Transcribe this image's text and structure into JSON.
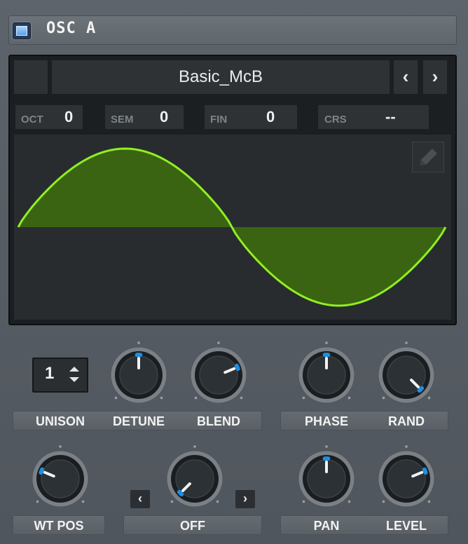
{
  "header": {
    "title": "OSC A",
    "power_on": true
  },
  "wavetable": {
    "name": "Basic_McB",
    "nav_prev": "‹",
    "nav_next": "›"
  },
  "pitch": [
    {
      "label": "OCT",
      "value": "0"
    },
    {
      "label": "SEM",
      "value": "0"
    },
    {
      "label": "FIN",
      "value": "0"
    },
    {
      "label": "CRS",
      "value": "--"
    }
  ],
  "colors": {
    "wave_stroke": "#90f020",
    "wave_fill": "#3c6a10",
    "knob_marker": "#1f8fe0",
    "panel_bg": "#1c1f22"
  },
  "unison": {
    "value": "1",
    "label": "UNISON"
  },
  "knobs": {
    "detune": {
      "label": "DETUNE",
      "value": 0.5
    },
    "blend": {
      "label": "BLEND",
      "value": 0.75
    },
    "phase": {
      "label": "PHASE",
      "value": 0.5
    },
    "rand": {
      "label": "RAND",
      "value": 1.0
    },
    "wt_pos": {
      "label": "WT POS",
      "value": 0.25
    },
    "warp": {
      "label": "OFF",
      "value": 0.0
    },
    "pan": {
      "label": "PAN",
      "value": 0.5
    },
    "level": {
      "label": "LEVEL",
      "value": 0.75
    }
  },
  "warp_nav": {
    "prev": "‹",
    "next": "›"
  }
}
